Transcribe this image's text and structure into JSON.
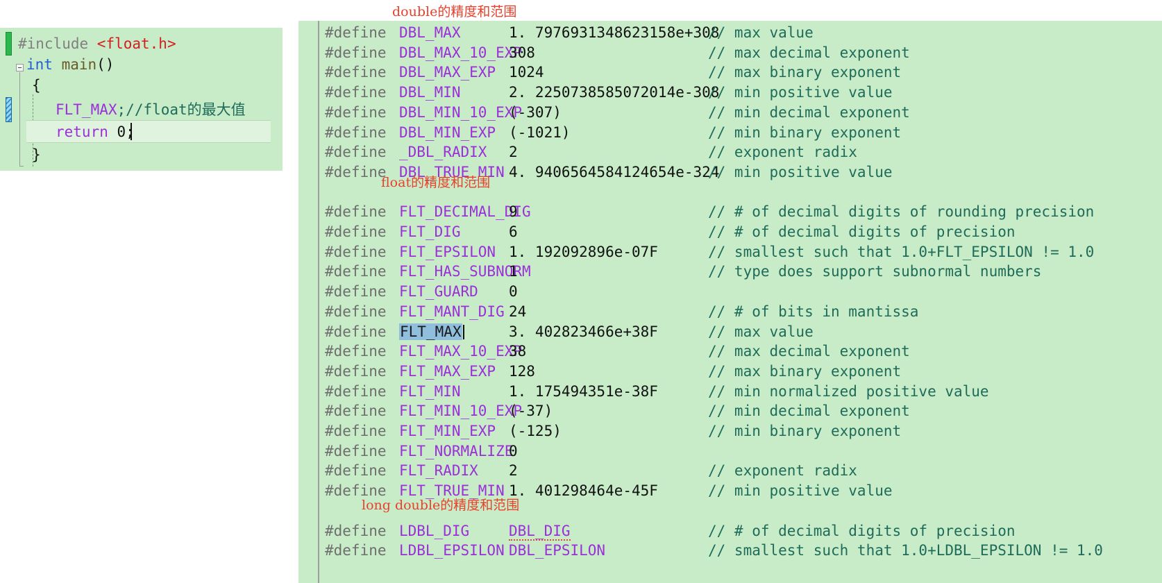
{
  "annotations": {
    "double_title": "double的精度和范围",
    "float_title": "float的精度和范围",
    "long_double_title": "long double的精度和范围"
  },
  "editor": {
    "lines": [
      {
        "pre": "#include ",
        "inc": "<float.h>"
      },
      {
        "kw": "int ",
        "fn": "main",
        "punct": "()"
      },
      {
        "punct": "{"
      },
      {
        "macro": "FLT_MAX",
        "punct": ";",
        "com": "//float的最大值"
      },
      {
        "kw": "return ",
        "num": "0",
        "punct": ";"
      },
      {
        "punct": "}"
      }
    ],
    "gutter": {
      "saved_marker": "saved-change-bar",
      "unsaved_marker": "unsaved-change-bar",
      "fold_marker": "collapse-box"
    }
  },
  "header_listing": {
    "define_keyword": "#define",
    "rows": [
      {
        "name": "DBL_MAX",
        "value": "1. 7976931348623158e+308",
        "comment": "// max value"
      },
      {
        "name": "DBL_MAX_10_EXP",
        "value": "308",
        "comment": "// max decimal exponent"
      },
      {
        "name": "DBL_MAX_EXP",
        "value": "1024",
        "comment": "// max binary exponent"
      },
      {
        "name": "DBL_MIN",
        "value": "2. 2250738585072014e-308",
        "comment": "// min positive value"
      },
      {
        "name": "DBL_MIN_10_EXP",
        "value": "(-307)",
        "comment": "// min decimal exponent"
      },
      {
        "name": "DBL_MIN_EXP",
        "value": "(-1021)",
        "comment": "// min binary exponent"
      },
      {
        "name": "_DBL_RADIX",
        "value": "2",
        "comment": "// exponent radix"
      },
      {
        "name": "DBL_TRUE_MIN",
        "value": "4. 9406564584124654e-324",
        "comment": "// min positive value"
      },
      {
        "blank": true
      },
      {
        "name": "FLT_DECIMAL_DIG",
        "value": "9",
        "comment": "// # of decimal digits of rounding precision"
      },
      {
        "name": "FLT_DIG",
        "value": "6",
        "comment": "// # of decimal digits of precision"
      },
      {
        "name": "FLT_EPSILON",
        "value": "1. 192092896e-07F",
        "comment": "// smallest such that 1.0+FLT_EPSILON != 1.0"
      },
      {
        "name": "FLT_HAS_SUBNORM",
        "value": "1",
        "comment": "// type does support subnormal numbers"
      },
      {
        "name": "FLT_GUARD",
        "value": "0",
        "comment": ""
      },
      {
        "name": "FLT_MANT_DIG",
        "value": "24",
        "comment": "// # of bits in mantissa"
      },
      {
        "name": "FLT_MAX",
        "value": "3. 402823466e+38F",
        "comment": "// max value",
        "selected": true
      },
      {
        "name": "FLT_MAX_10_EXP",
        "value": "38",
        "comment": "// max decimal exponent"
      },
      {
        "name": "FLT_MAX_EXP",
        "value": "128",
        "comment": "// max binary exponent"
      },
      {
        "name": "FLT_MIN",
        "value": "1. 175494351e-38F",
        "comment": "// min normalized positive value"
      },
      {
        "name": "FLT_MIN_10_EXP",
        "value": "(-37)",
        "comment": "// min decimal exponent"
      },
      {
        "name": "FLT_MIN_EXP",
        "value": "(-125)",
        "comment": "// min binary exponent"
      },
      {
        "name": "FLT_NORMALIZE",
        "value": "0",
        "comment": ""
      },
      {
        "name": "FLT_RADIX",
        "value": "2",
        "comment": "// exponent radix"
      },
      {
        "name": "FLT_TRUE_MIN",
        "value": "1. 401298464e-45F",
        "comment": "// min positive value"
      },
      {
        "blank": true
      },
      {
        "name": "LDBL_DIG",
        "value": "DBL_DIG",
        "value_is_macro": true,
        "value_squiggle": true,
        "comment": "// # of decimal digits of precision"
      },
      {
        "name": "LDBL_EPSILON",
        "value": "DBL_EPSILON",
        "value_is_macro": true,
        "comment": "// smallest such that 1.0+LDBL_EPSILON != 1.0"
      }
    ]
  },
  "colors": {
    "code_background": "#c8ecc8",
    "macro_purple": "#9b30d9",
    "comment_teal": "#1f6b5a",
    "annotation_red": "#e8402a",
    "keyword_blue": "#1f5fd6",
    "include_red": "#d21f1f",
    "selection_blue": "#8fbfdd",
    "current_line": "#dff3df"
  }
}
